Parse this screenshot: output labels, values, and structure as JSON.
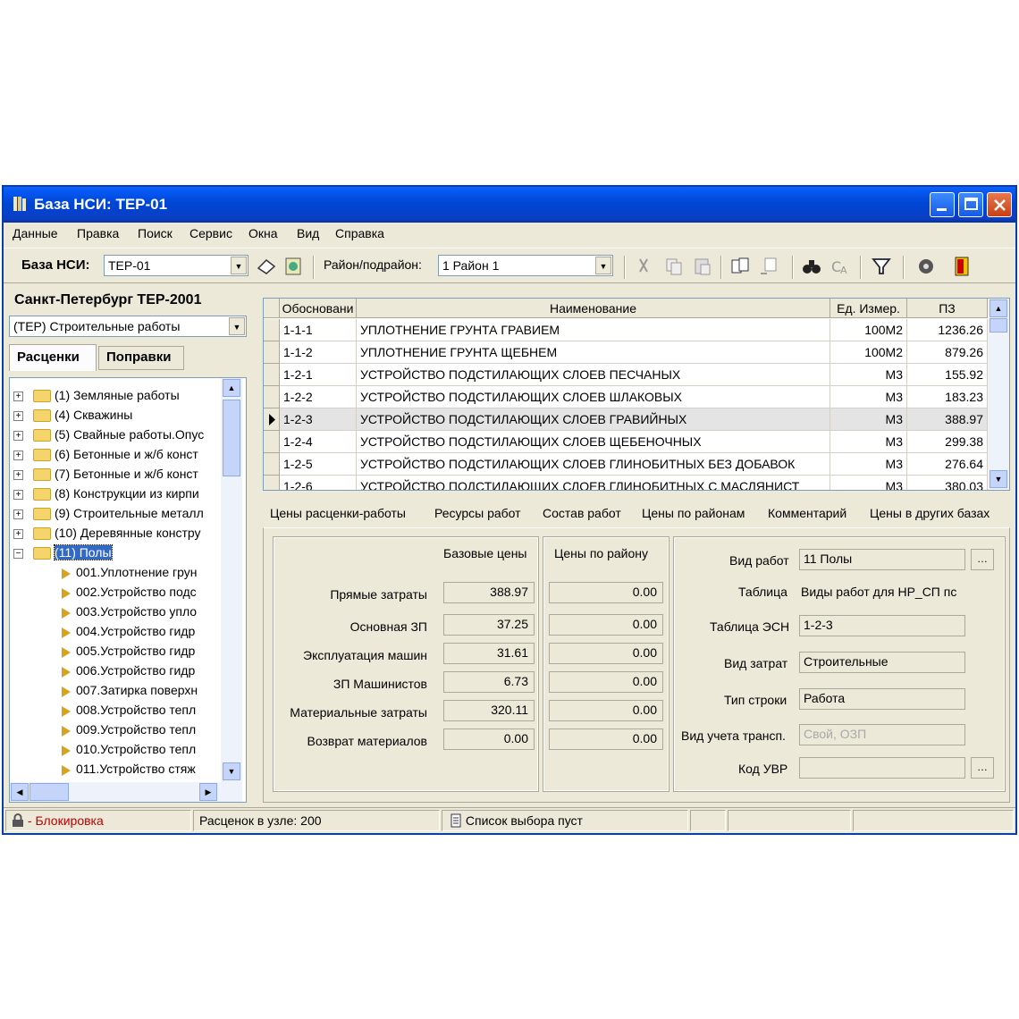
{
  "window": {
    "title": "База НСИ: ТЕР-01"
  },
  "menu": [
    "Данные",
    "Правка",
    "Поиск",
    "Сервис",
    "Окна",
    "Вид",
    "Справка"
  ],
  "toolbar": {
    "base_label": "База НСИ:",
    "base_value": "ТЕР-01",
    "region_label": "Район/подрайон:",
    "region_value": "1 Район 1"
  },
  "left": {
    "heading": "Санкт-Петербург ТЕР-2001",
    "collection": "(ТЕР) Строительные работы",
    "tabs": [
      "Расценки",
      "Поправки"
    ],
    "tree": [
      {
        "label": "(1) Земляные работы",
        "kind": "folder"
      },
      {
        "label": "(4) Скважины",
        "kind": "folder"
      },
      {
        "label": "(5) Свайные работы.Опус",
        "kind": "folder"
      },
      {
        "label": "(6) Бетонные и ж/б конст",
        "kind": "folder"
      },
      {
        "label": "(7) Бетонные и ж/б конст",
        "kind": "folder"
      },
      {
        "label": "(8) Конструкции из кирпи",
        "kind": "folder"
      },
      {
        "label": "(9) Строительные металл",
        "kind": "folder"
      },
      {
        "label": "(10) Деревянные констру",
        "kind": "folder"
      },
      {
        "label": "(11) Полы",
        "kind": "open",
        "selected": true
      },
      {
        "label": "001.Уплотнение грун",
        "kind": "leaf"
      },
      {
        "label": "002.Устройство подс",
        "kind": "leaf"
      },
      {
        "label": "003.Устройство упло",
        "kind": "leaf"
      },
      {
        "label": "004.Устройство гидр",
        "kind": "leaf"
      },
      {
        "label": "005.Устройство гидр",
        "kind": "leaf"
      },
      {
        "label": "006.Устройство гидр",
        "kind": "leaf"
      },
      {
        "label": "007.Затирка поверхн",
        "kind": "leaf"
      },
      {
        "label": "008.Устройство тепл",
        "kind": "leaf"
      },
      {
        "label": "009.Устройство тепл",
        "kind": "leaf"
      },
      {
        "label": "010.Устройство тепл",
        "kind": "leaf"
      },
      {
        "label": "011.Устройство стяж",
        "kind": "leaf"
      }
    ]
  },
  "grid": {
    "columns": [
      "Обосновани",
      "Наименование",
      "Ед. Измер.",
      "ПЗ"
    ],
    "rows": [
      [
        "1-1-1",
        "УПЛОТНЕНИЕ ГРУНТА ГРАВИЕМ",
        "100М2",
        "1236.26"
      ],
      [
        "1-1-2",
        "УПЛОТНЕНИЕ ГРУНТА ЩЕБНЕМ",
        "100М2",
        "879.26"
      ],
      [
        "1-2-1",
        "УСТРОЙСТВО ПОДСТИЛАЮЩИХ СЛОЕВ ПЕСЧАНЫХ",
        "М3",
        "155.92"
      ],
      [
        "1-2-2",
        "УСТРОЙСТВО ПОДСТИЛАЮЩИХ СЛОЕВ ШЛАКОВЫХ",
        "М3",
        "183.23"
      ],
      [
        "1-2-3",
        "УСТРОЙСТВО ПОДСТИЛАЮЩИХ СЛОЕВ ГРАВИЙНЫХ",
        "М3",
        "388.97"
      ],
      [
        "1-2-4",
        "УСТРОЙСТВО ПОДСТИЛАЮЩИХ СЛОЕВ ЩЕБЕНОЧНЫХ",
        "М3",
        "299.38"
      ],
      [
        "1-2-5",
        "УСТРОЙСТВО ПОДСТИЛАЮЩИХ СЛОЕВ ГЛИНОБИТНЫХ БЕЗ ДОБАВОК",
        "М3",
        "276.64"
      ],
      [
        "1-2-6",
        "УСТРОЙСТВО ПОДСТИЛАЮЩИХ СЛОЕВ ГЛИНОБИТНЫХ С МАСЛЯНИСТ",
        "М3",
        "380.03"
      ]
    ],
    "current_row": 4
  },
  "detail_tabs": [
    "Цены расценки-работы",
    "Ресурсы работ",
    "Состав работ",
    "Цены по районам",
    "Комментарий",
    "Цены в других базах"
  ],
  "prices": {
    "col_base": "Базовые цены",
    "col_region": "Цены по району",
    "rows": [
      {
        "label": "Прямые затраты",
        "base": "388.97",
        "region": "0.00"
      },
      {
        "label": "Основная ЗП",
        "base": "37.25",
        "region": "0.00"
      },
      {
        "label": "Эксплуатация машин",
        "base": "31.61",
        "region": "0.00"
      },
      {
        "label": "ЗП Машинистов",
        "base": "6.73",
        "region": "0.00"
      },
      {
        "label": "Материальные затраты",
        "base": "320.11",
        "region": "0.00"
      },
      {
        "label": "Возврат материалов",
        "base": "0.00",
        "region": "0.00"
      }
    ]
  },
  "props": {
    "work_type_label": "Вид работ",
    "work_type_value": "11 Полы",
    "table_label": "Таблица",
    "table_value": "Виды работ для НР_СП пс",
    "esn_label": "Таблица ЭСН",
    "esn_value": "1-2-3",
    "cost_label": "Вид затрат",
    "cost_value": "Строительные",
    "row_type_label": "Тип строки",
    "row_type_value": "Работа",
    "transport_label": "Вид учета трансп.",
    "transport_value": "Свой, ОЗП",
    "uvr_label": "Код УВР",
    "uvr_value": ""
  },
  "status": {
    "lock": "- Блокировка",
    "count": "Расценок в узле: 200",
    "selection": "Список выбора пуст"
  }
}
